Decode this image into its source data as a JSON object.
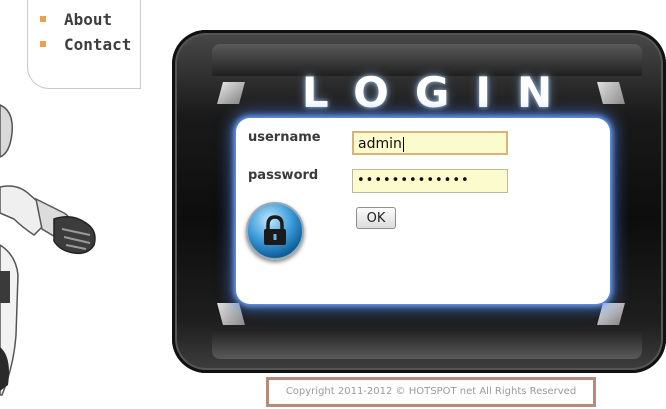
{
  "nav": {
    "items": [
      {
        "label": "About"
      },
      {
        "label": "Contact"
      }
    ]
  },
  "login": {
    "title": "LOGIN",
    "username_label": "username",
    "username_value": "admin",
    "password_label": "password",
    "password_value": "•••••••••••••",
    "submit_label": "OK"
  },
  "footer": {
    "copyright": "Copyright 2011-2012 © HOTSPOT net All Rights Reserved"
  },
  "colors": {
    "panel_glow": "#6fa6ff",
    "input_bg": "#fbfbcd",
    "bullet": "#e8a24a",
    "footer_border": "#b88a78"
  },
  "icons": {
    "lock": "padlock-icon"
  }
}
